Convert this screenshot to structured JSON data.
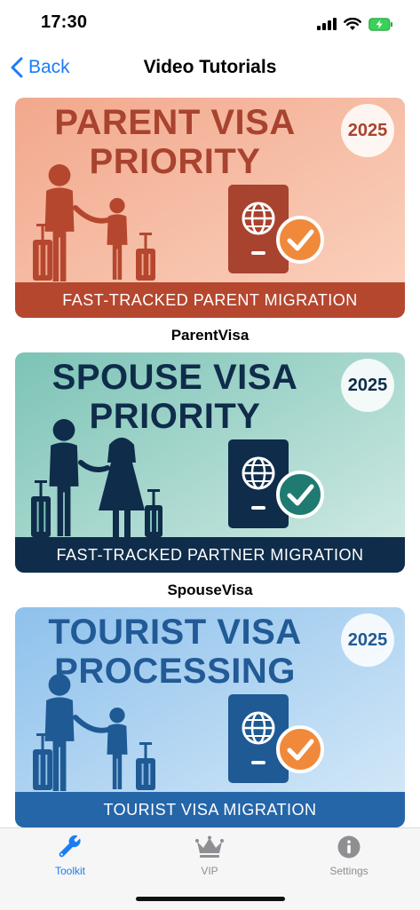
{
  "status": {
    "time": "17:30"
  },
  "nav": {
    "back_label": "Back",
    "title": "Video Tutorials"
  },
  "cards": [
    {
      "title_line1": "PARENT VISA",
      "title_line2": "PRIORITY",
      "year": "2025",
      "strip_text": "FAST-TRACKED PARENT MIGRATION",
      "caption": "ParentVisa",
      "colors": {
        "bg_start": "#f2a88d",
        "bg_end": "#fbd3bf",
        "title": "#a8432f",
        "figure": "#b5472f",
        "passport": "#a8432f",
        "check": "#f08a3a",
        "strip": "#b5472f"
      }
    },
    {
      "title_line1": "SPOUSE VISA",
      "title_line2": "PRIORITY",
      "year": "2025",
      "strip_text": "FAST-TRACKED PARTNER MIGRATION",
      "caption": "SpouseVisa",
      "colors": {
        "bg_start": "#7cc3b6",
        "bg_end": "#d4ece6",
        "title": "#0f2c4a",
        "figure": "#0f2c4a",
        "passport": "#0f2c4a",
        "check": "#1f7a72",
        "strip": "#0f2c4a"
      }
    },
    {
      "title_line1": "TOURIST VISA",
      "title_line2": "PROCESSING",
      "year": "2025",
      "strip_text": "TOURIST VISA MIGRATION",
      "caption": "",
      "colors": {
        "bg_start": "#8ec1ec",
        "bg_end": "#d7eaf8",
        "title": "#215a96",
        "figure": "#1f5a94",
        "passport": "#1f5a94",
        "check": "#f08a3a",
        "strip": "#2566a8"
      }
    }
  ],
  "tabbar": {
    "items": [
      {
        "label": "Toolkit",
        "icon": "wrench-icon",
        "active": true
      },
      {
        "label": "VIP",
        "icon": "crown-icon",
        "active": false
      },
      {
        "label": "Settings",
        "icon": "info-icon",
        "active": false
      }
    ],
    "active_color": "#1a7cf5",
    "inactive_color": "#8e8e93"
  }
}
